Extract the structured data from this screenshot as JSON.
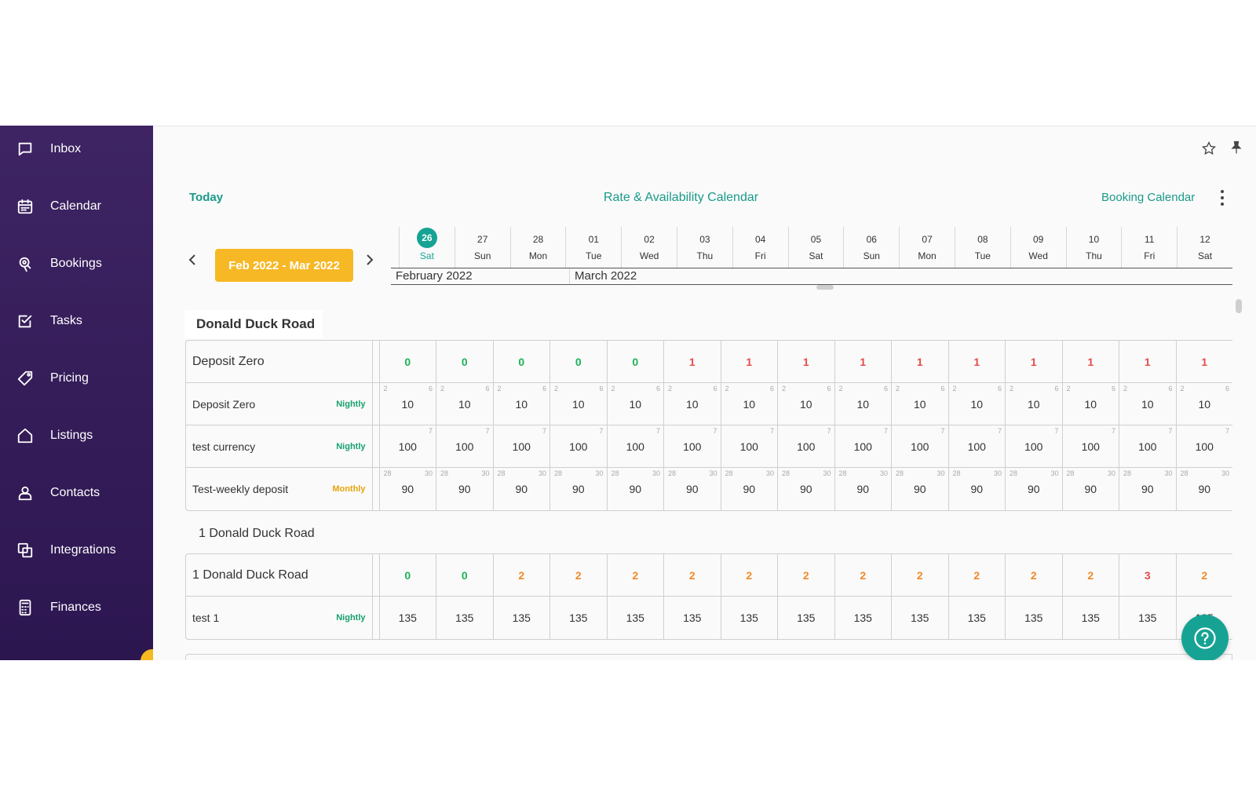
{
  "sidebar": {
    "items": [
      {
        "label": "Inbox",
        "icon": "chat-icon"
      },
      {
        "label": "Calendar",
        "icon": "calendar-icon"
      },
      {
        "label": "Bookings",
        "icon": "bookings-icon"
      },
      {
        "label": "Tasks",
        "icon": "tasks-icon"
      },
      {
        "label": "Pricing",
        "icon": "tag-icon"
      },
      {
        "label": "Listings",
        "icon": "home-icon"
      },
      {
        "label": "Contacts",
        "icon": "user-icon"
      },
      {
        "label": "Integrations",
        "icon": "integrations-icon"
      },
      {
        "label": "Finances",
        "icon": "calculator-icon"
      }
    ]
  },
  "header": {
    "today_label": "Today",
    "title": "Rate & Availability Calendar",
    "booking_calendar_label": "Booking Calendar",
    "range_label": "Feb 2022 - Mar 2022"
  },
  "dates": [
    {
      "num": "26",
      "day": "Sat",
      "today": true
    },
    {
      "num": "27",
      "day": "Sun"
    },
    {
      "num": "28",
      "day": "Mon"
    },
    {
      "num": "01",
      "day": "Tue"
    },
    {
      "num": "02",
      "day": "Wed"
    },
    {
      "num": "03",
      "day": "Thu"
    },
    {
      "num": "04",
      "day": "Fri"
    },
    {
      "num": "05",
      "day": "Sat"
    },
    {
      "num": "06",
      "day": "Sun"
    },
    {
      "num": "07",
      "day": "Mon"
    },
    {
      "num": "08",
      "day": "Tue"
    },
    {
      "num": "09",
      "day": "Wed"
    },
    {
      "num": "10",
      "day": "Thu"
    },
    {
      "num": "11",
      "day": "Fri"
    },
    {
      "num": "12",
      "day": "Sat"
    }
  ],
  "months": {
    "first": "February 2022",
    "second": "March 2022"
  },
  "groups": [
    {
      "title": "Donald Duck Road",
      "rows": [
        {
          "label": "Deposit Zero",
          "type": "availability",
          "values": [
            "0",
            "0",
            "0",
            "0",
            "0",
            "1",
            "1",
            "1",
            "1",
            "1",
            "1",
            "1",
            "1",
            "1",
            "1"
          ],
          "colors": [
            "green",
            "green",
            "green",
            "green",
            "green",
            "red",
            "red",
            "red",
            "red",
            "red",
            "red",
            "red",
            "red",
            "red",
            "red"
          ]
        },
        {
          "label": "Deposit Zero",
          "tag": "Nightly",
          "tag_type": "nightly",
          "min": "2",
          "max": "6",
          "values": [
            "10",
            "10",
            "10",
            "10",
            "10",
            "10",
            "10",
            "10",
            "10",
            "10",
            "10",
            "10",
            "10",
            "10",
            "10"
          ]
        },
        {
          "label": "test currency",
          "tag": "Nightly",
          "tag_type": "nightly",
          "min": "",
          "max": "7",
          "values": [
            "100",
            "100",
            "100",
            "100",
            "100",
            "100",
            "100",
            "100",
            "100",
            "100",
            "100",
            "100",
            "100",
            "100",
            "100"
          ]
        },
        {
          "label": "Test-weekly deposit",
          "tag": "Monthly",
          "tag_type": "monthly",
          "min": "28",
          "max": "30",
          "values": [
            "90",
            "90",
            "90",
            "90",
            "90",
            "90",
            "90",
            "90",
            "90",
            "90",
            "90",
            "90",
            "90",
            "90",
            "90"
          ]
        }
      ]
    },
    {
      "title": "1 Donald Duck Road",
      "rows": [
        {
          "label": "1 Donald Duck Road",
          "type": "availability",
          "values": [
            "0",
            "0",
            "2",
            "2",
            "2",
            "2",
            "2",
            "2",
            "2",
            "2",
            "2",
            "2",
            "2",
            "3",
            "2"
          ],
          "colors": [
            "green",
            "green",
            "orange",
            "orange",
            "orange",
            "orange",
            "orange",
            "orange",
            "orange",
            "orange",
            "orange",
            "orange",
            "orange",
            "red",
            "orange"
          ]
        },
        {
          "label": "test 1",
          "tag": "Nightly",
          "tag_type": "nightly",
          "min": "",
          "max": "",
          "values": [
            "135",
            "135",
            "135",
            "135",
            "135",
            "135",
            "135",
            "135",
            "135",
            "135",
            "135",
            "135",
            "135",
            "135",
            "135"
          ]
        }
      ]
    }
  ]
}
